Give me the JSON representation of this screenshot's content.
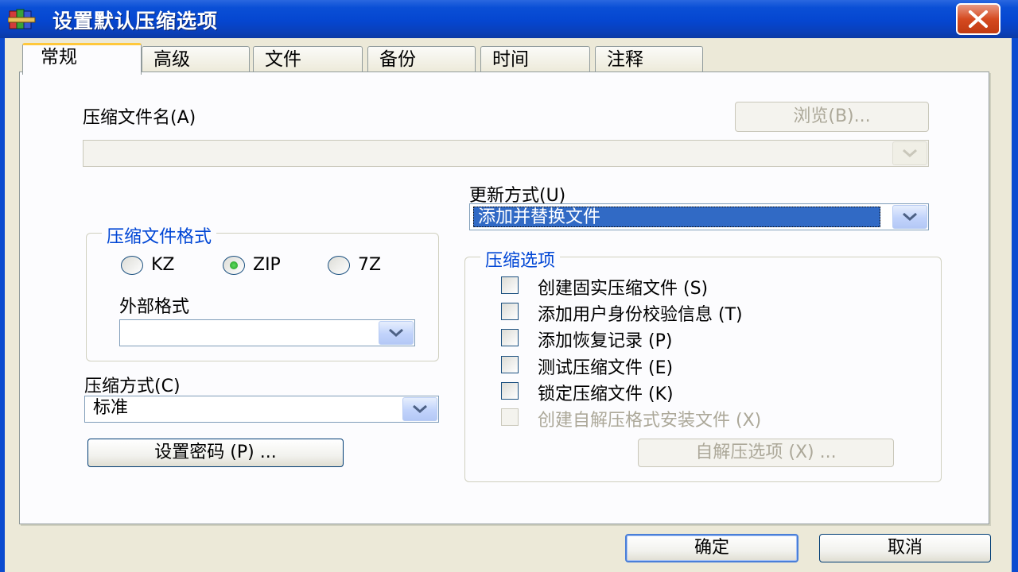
{
  "window": {
    "title": "设置默认压缩选项",
    "icon": "winrar-books-icon",
    "close_icon": "close-x-icon"
  },
  "tabs": [
    {
      "label": "常规",
      "active": true
    },
    {
      "label": "高级",
      "active": false
    },
    {
      "label": "文件",
      "active": false
    },
    {
      "label": "备份",
      "active": false
    },
    {
      "label": "时间",
      "active": false
    },
    {
      "label": "注释",
      "active": false
    }
  ],
  "archive_name": {
    "label": "压缩文件名(A)",
    "value": "",
    "browse_label": "浏览(B)..."
  },
  "update_mode": {
    "label": "更新方式(U)",
    "value": "添加并替换文件"
  },
  "archive_format": {
    "title": "压缩文件格式",
    "options": [
      {
        "label": "KZ",
        "selected": false
      },
      {
        "label": "ZIP",
        "selected": true
      },
      {
        "label": "7Z",
        "selected": false
      }
    ],
    "external_label": "外部格式",
    "external_value": ""
  },
  "compression_method": {
    "label": "压缩方式(C)",
    "value": "标准"
  },
  "set_password_label": "设置密码 (P) ...",
  "compression_options": {
    "title": "压缩选项",
    "items": [
      {
        "label": "创建固实压缩文件 (S)",
        "checked": false,
        "enabled": true
      },
      {
        "label": "添加用户身份校验信息 (T)",
        "checked": false,
        "enabled": true
      },
      {
        "label": "添加恢复记录 (P)",
        "checked": false,
        "enabled": true
      },
      {
        "label": "测试压缩文件 (E)",
        "checked": false,
        "enabled": true
      },
      {
        "label": "锁定压缩文件 (K)",
        "checked": false,
        "enabled": true
      },
      {
        "label": "创建自解压格式安装文件 (X)",
        "checked": false,
        "enabled": false
      }
    ],
    "sfx_options_label": "自解压选项 (X) ..."
  },
  "footer": {
    "ok_label": "确定",
    "cancel_label": "取消"
  },
  "colors": {
    "titlebar": "#0546d0",
    "dialog_bg": "#ece9d8",
    "group_title": "#0046d5",
    "selection": "#316ac5",
    "active_tab_accent": "#ffc83c"
  }
}
